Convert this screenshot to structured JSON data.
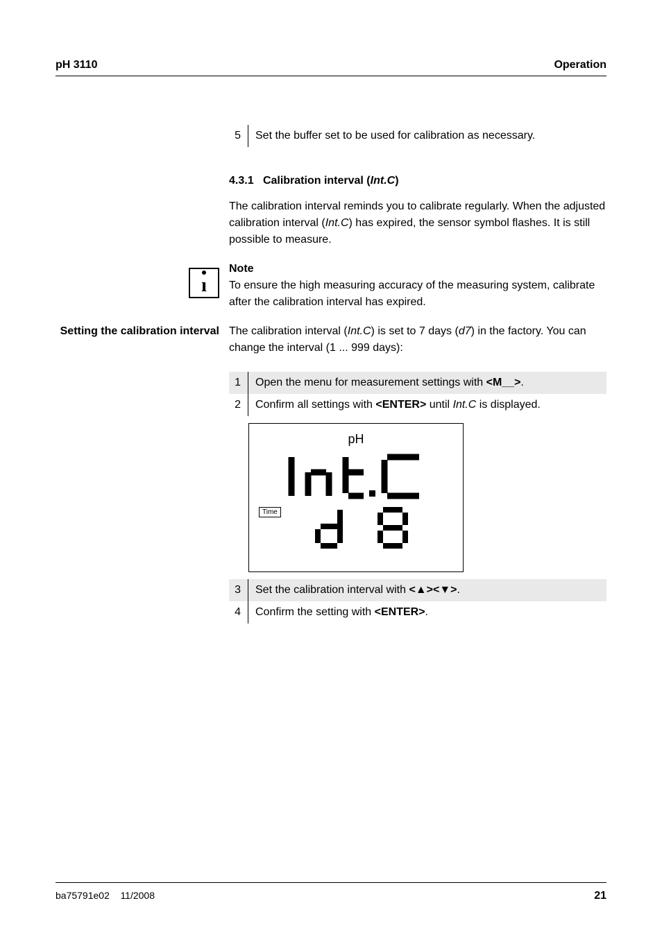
{
  "header": {
    "left": "pH 3110",
    "right": "Operation"
  },
  "step5": {
    "num": "5",
    "text": "Set the buffer set to be used for calibration as necessary."
  },
  "section": {
    "num": "4.3.1",
    "title_pre": "Calibration interval (",
    "title_ital": "Int.C",
    "title_post": ")"
  },
  "para1": {
    "pre": "The calibration interval reminds you to calibrate regularly. When the adjusted calibration interval (",
    "ital": "Int.C",
    "post": ") has expired, the sensor symbol flashes.  It is still possible to measure."
  },
  "note": {
    "heading": "Note",
    "text": "To ensure the high measuring accuracy of the measuring system, calibrate after the calibration interval has expired."
  },
  "side_heading": "Setting the calibration interval",
  "para2": {
    "pre": "The calibration interval (",
    "ital1": "Int.C",
    "mid1": ") is set to 7 days (",
    "ital2": "d7",
    "mid2": ") in the factory. You can change the interval (1 ... 999 days):"
  },
  "steps": {
    "s1": {
      "num": "1",
      "pre": "Open the menu for measurement settings with ",
      "bold": "<M__>",
      "post": "."
    },
    "s2": {
      "num": "2",
      "pre": "Confirm all settings with ",
      "bold": "<ENTER>",
      "mid": " until ",
      "ital": "Int.C",
      "post": " is displayed."
    },
    "s3": {
      "num": "3",
      "pre": "Set the calibration interval with ",
      "b1": "<",
      "a1": "▲",
      "b2": "><",
      "a2": "▼",
      "b3": ">",
      "post": "."
    },
    "s4": {
      "num": "4",
      "pre": "Confirm the setting with ",
      "bold": "<ENTER>",
      "post": "."
    }
  },
  "display": {
    "ph": "pH",
    "time": "Time"
  },
  "footer": {
    "doc": "ba75791e02",
    "date": "11/2008",
    "page": "21"
  }
}
